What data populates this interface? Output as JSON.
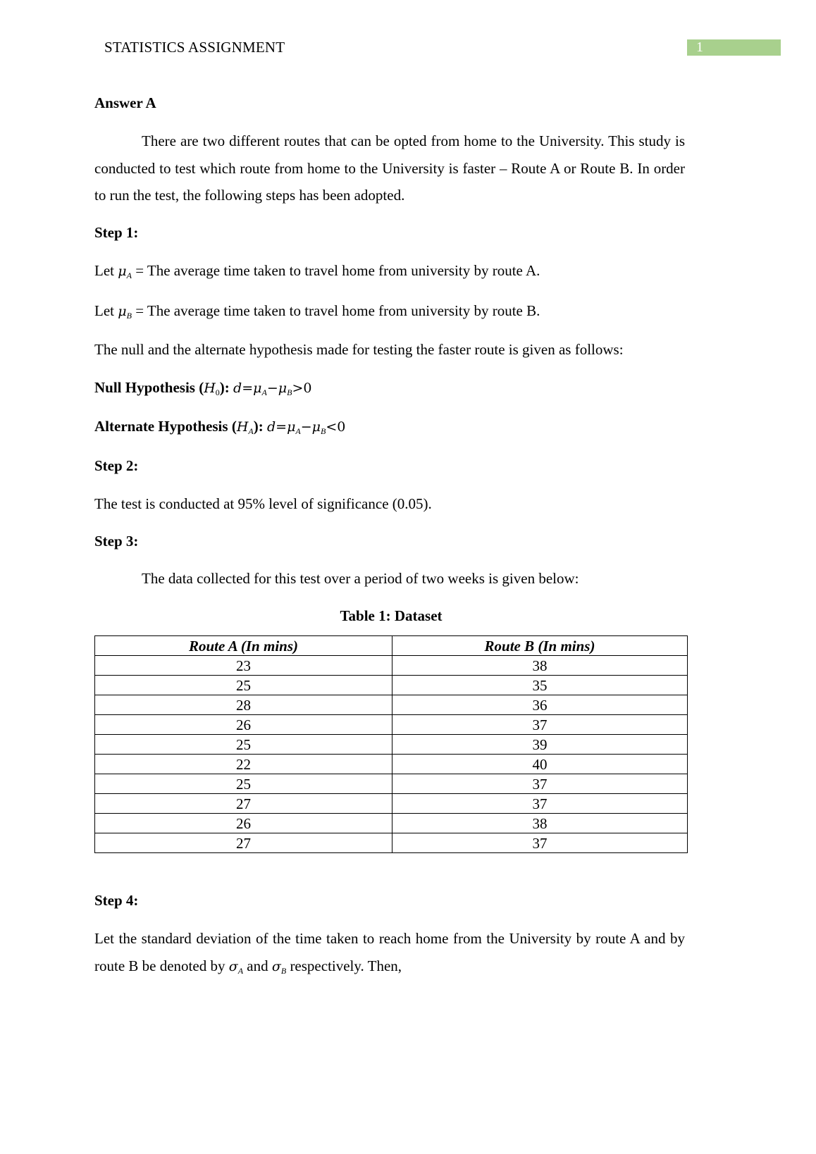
{
  "header": {
    "title": "STATISTICS ASSIGNMENT",
    "page_number": "1",
    "page_number_color": "#a8d08d"
  },
  "answer_heading": "Answer A",
  "intro": "There are two different routes that can be opted from home to the University. This study is conducted to test which route from home to the University is faster – Route A or Route B. In order to run the test, the following steps has been adopted.",
  "step1": {
    "heading": "Step 1:",
    "let_a": {
      "prefix": "Let ",
      "symbol": "μ",
      "sub": "A",
      "text": " = The average time taken to travel home from university by route A."
    },
    "let_b": {
      "prefix": "Let ",
      "symbol": "μ",
      "sub": "B",
      "text": " = The average time taken to travel home from university by route B."
    },
    "hyp_intro": "The null and the alternate hypothesis made for testing the faster route is given as follows:",
    "null": {
      "label": "Null Hypothesis (",
      "H": "H",
      "sub": "0",
      "close": "): ",
      "lhs": "d=μ",
      "sub1": "A",
      "minus": "−μ",
      "sub2": "B",
      "rel": ">0"
    },
    "alt": {
      "label": "Alternate Hypothesis (",
      "H": "H",
      "sub": "A",
      "close": "): ",
      "lhs": "d=μ",
      "sub1": "A",
      "minus": "−μ",
      "sub2": "B",
      "rel": "<0"
    }
  },
  "step2": {
    "heading": "Step 2:",
    "text": "The test is conducted at 95% level of significance (0.05)."
  },
  "step3": {
    "heading": "Step 3:",
    "text": "The data collected for this test over a period of two weeks is given below:"
  },
  "table": {
    "caption": "Table 1: Dataset",
    "headers": [
      "Route A (In mins)",
      "Route B (In mins)"
    ],
    "rows": [
      [
        "23",
        "38"
      ],
      [
        "25",
        "35"
      ],
      [
        "28",
        "36"
      ],
      [
        "26",
        "37"
      ],
      [
        "25",
        "39"
      ],
      [
        "22",
        "40"
      ],
      [
        "25",
        "37"
      ],
      [
        "27",
        "37"
      ],
      [
        "26",
        "38"
      ],
      [
        "27",
        "37"
      ]
    ]
  },
  "step4": {
    "heading": "Step 4:",
    "text1": "Let the standard deviation of the time taken to reach home from the University by route A and by route B be denoted by ",
    "sigma": "σ",
    "sub_a": "A",
    "and": " and ",
    "sub_b": "B",
    "text2": " respectively. Then,"
  }
}
